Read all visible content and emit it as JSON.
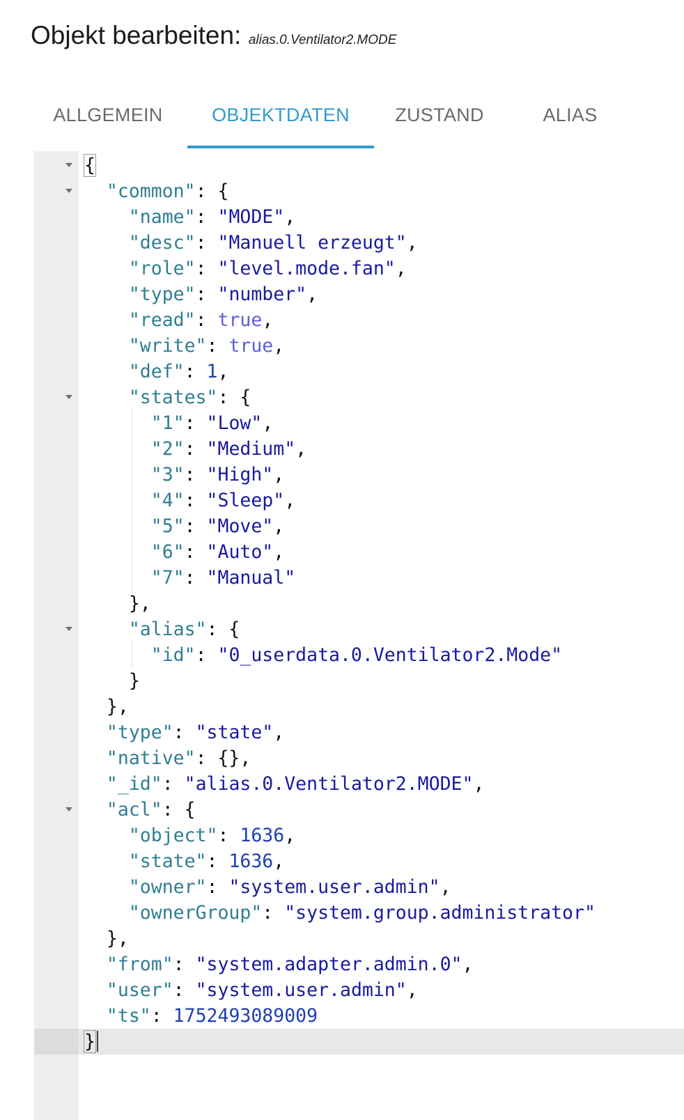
{
  "header": {
    "title": "Objekt bearbeiten:",
    "object_id": "alias.0.Ventilator2.MODE"
  },
  "tabs": [
    {
      "label": "ALLGEMEIN",
      "active": false
    },
    {
      "label": "OBJEKTDATEN",
      "active": true
    },
    {
      "label": "ZUSTAND",
      "active": false
    },
    {
      "label": "ALIAS",
      "active": false
    }
  ],
  "colors": {
    "accent": "#3399cc",
    "key": "#2f7e93",
    "string": "#1a1a9e",
    "number": "#1f3fb0",
    "boolean": "#6060d8"
  },
  "editor": {
    "lines": [
      {
        "indent": 0,
        "fold": true,
        "parts": [
          [
            "p",
            "{"
          ]
        ],
        "box_open": true
      },
      {
        "indent": 1,
        "fold": true,
        "parts": [
          [
            "k",
            "\"common\""
          ],
          [
            "p",
            ": {"
          ]
        ]
      },
      {
        "indent": 2,
        "parts": [
          [
            "k",
            "\"name\""
          ],
          [
            "p",
            ": "
          ],
          [
            "s",
            "\"MODE\""
          ],
          [
            "p",
            ","
          ]
        ]
      },
      {
        "indent": 2,
        "parts": [
          [
            "k",
            "\"desc\""
          ],
          [
            "p",
            ": "
          ],
          [
            "s",
            "\"Manuell erzeugt\""
          ],
          [
            "p",
            ","
          ]
        ]
      },
      {
        "indent": 2,
        "parts": [
          [
            "k",
            "\"role\""
          ],
          [
            "p",
            ": "
          ],
          [
            "s",
            "\"level.mode.fan\""
          ],
          [
            "p",
            ","
          ]
        ]
      },
      {
        "indent": 2,
        "parts": [
          [
            "k",
            "\"type\""
          ],
          [
            "p",
            ": "
          ],
          [
            "s",
            "\"number\""
          ],
          [
            "p",
            ","
          ]
        ]
      },
      {
        "indent": 2,
        "parts": [
          [
            "k",
            "\"read\""
          ],
          [
            "p",
            ": "
          ],
          [
            "b",
            "true"
          ],
          [
            "p",
            ","
          ]
        ]
      },
      {
        "indent": 2,
        "parts": [
          [
            "k",
            "\"write\""
          ],
          [
            "p",
            ": "
          ],
          [
            "b",
            "true"
          ],
          [
            "p",
            ","
          ]
        ]
      },
      {
        "indent": 2,
        "parts": [
          [
            "k",
            "\"def\""
          ],
          [
            "p",
            ": "
          ],
          [
            "n",
            "1"
          ],
          [
            "p",
            ","
          ]
        ]
      },
      {
        "indent": 2,
        "fold": true,
        "parts": [
          [
            "k",
            "\"states\""
          ],
          [
            "p",
            ": {"
          ]
        ]
      },
      {
        "indent": 3,
        "guide": true,
        "parts": [
          [
            "k",
            "\"1\""
          ],
          [
            "p",
            ": "
          ],
          [
            "s",
            "\"Low\""
          ],
          [
            "p",
            ","
          ]
        ]
      },
      {
        "indent": 3,
        "guide": true,
        "parts": [
          [
            "k",
            "\"2\""
          ],
          [
            "p",
            ": "
          ],
          [
            "s",
            "\"Medium\""
          ],
          [
            "p",
            ","
          ]
        ]
      },
      {
        "indent": 3,
        "guide": true,
        "parts": [
          [
            "k",
            "\"3\""
          ],
          [
            "p",
            ": "
          ],
          [
            "s",
            "\"High\""
          ],
          [
            "p",
            ","
          ]
        ]
      },
      {
        "indent": 3,
        "guide": true,
        "parts": [
          [
            "k",
            "\"4\""
          ],
          [
            "p",
            ": "
          ],
          [
            "s",
            "\"Sleep\""
          ],
          [
            "p",
            ","
          ]
        ]
      },
      {
        "indent": 3,
        "guide": true,
        "parts": [
          [
            "k",
            "\"5\""
          ],
          [
            "p",
            ": "
          ],
          [
            "s",
            "\"Move\""
          ],
          [
            "p",
            ","
          ]
        ]
      },
      {
        "indent": 3,
        "guide": true,
        "parts": [
          [
            "k",
            "\"6\""
          ],
          [
            "p",
            ": "
          ],
          [
            "s",
            "\"Auto\""
          ],
          [
            "p",
            ","
          ]
        ]
      },
      {
        "indent": 3,
        "guide": true,
        "parts": [
          [
            "k",
            "\"7\""
          ],
          [
            "p",
            ": "
          ],
          [
            "s",
            "\"Manual\""
          ]
        ]
      },
      {
        "indent": 2,
        "parts": [
          [
            "p",
            "},"
          ]
        ]
      },
      {
        "indent": 2,
        "fold": true,
        "parts": [
          [
            "k",
            "\"alias\""
          ],
          [
            "p",
            ": {"
          ]
        ]
      },
      {
        "indent": 3,
        "guide": true,
        "parts": [
          [
            "k",
            "\"id\""
          ],
          [
            "p",
            ": "
          ],
          [
            "s",
            "\"0_userdata.0.Ventilator2.Mode\""
          ]
        ]
      },
      {
        "indent": 2,
        "parts": [
          [
            "p",
            "}"
          ]
        ]
      },
      {
        "indent": 1,
        "parts": [
          [
            "p",
            "},"
          ]
        ]
      },
      {
        "indent": 1,
        "parts": [
          [
            "k",
            "\"type\""
          ],
          [
            "p",
            ": "
          ],
          [
            "s",
            "\"state\""
          ],
          [
            "p",
            ","
          ]
        ]
      },
      {
        "indent": 1,
        "parts": [
          [
            "k",
            "\"native\""
          ],
          [
            "p",
            ": {},"
          ]
        ]
      },
      {
        "indent": 1,
        "parts": [
          [
            "k",
            "\"_id\""
          ],
          [
            "p",
            ": "
          ],
          [
            "s",
            "\"alias.0.Ventilator2.MODE\""
          ],
          [
            "p",
            ","
          ]
        ]
      },
      {
        "indent": 1,
        "fold": true,
        "parts": [
          [
            "k",
            "\"acl\""
          ],
          [
            "p",
            ": {"
          ]
        ]
      },
      {
        "indent": 2,
        "parts": [
          [
            "k",
            "\"object\""
          ],
          [
            "p",
            ": "
          ],
          [
            "n",
            "1636"
          ],
          [
            "p",
            ","
          ]
        ]
      },
      {
        "indent": 2,
        "parts": [
          [
            "k",
            "\"state\""
          ],
          [
            "p",
            ": "
          ],
          [
            "n",
            "1636"
          ],
          [
            "p",
            ","
          ]
        ]
      },
      {
        "indent": 2,
        "parts": [
          [
            "k",
            "\"owner\""
          ],
          [
            "p",
            ": "
          ],
          [
            "s",
            "\"system.user.admin\""
          ],
          [
            "p",
            ","
          ]
        ]
      },
      {
        "indent": 2,
        "parts": [
          [
            "k",
            "\"ownerGroup\""
          ],
          [
            "p",
            ": "
          ],
          [
            "s",
            "\"system.group.administrator\""
          ]
        ]
      },
      {
        "indent": 1,
        "parts": [
          [
            "p",
            "},"
          ]
        ]
      },
      {
        "indent": 1,
        "parts": [
          [
            "k",
            "\"from\""
          ],
          [
            "p",
            ": "
          ],
          [
            "s",
            "\"system.adapter.admin.0\""
          ],
          [
            "p",
            ","
          ]
        ]
      },
      {
        "indent": 1,
        "parts": [
          [
            "k",
            "\"user\""
          ],
          [
            "p",
            ": "
          ],
          [
            "s",
            "\"system.user.admin\""
          ],
          [
            "p",
            ","
          ]
        ]
      },
      {
        "indent": 1,
        "parts": [
          [
            "k",
            "\"ts\""
          ],
          [
            "p",
            ": "
          ],
          [
            "n",
            "1752493089009"
          ]
        ]
      },
      {
        "indent": 0,
        "current": true,
        "box_open": true,
        "cursor": true,
        "parts": [
          [
            "p",
            "}"
          ]
        ]
      }
    ]
  }
}
